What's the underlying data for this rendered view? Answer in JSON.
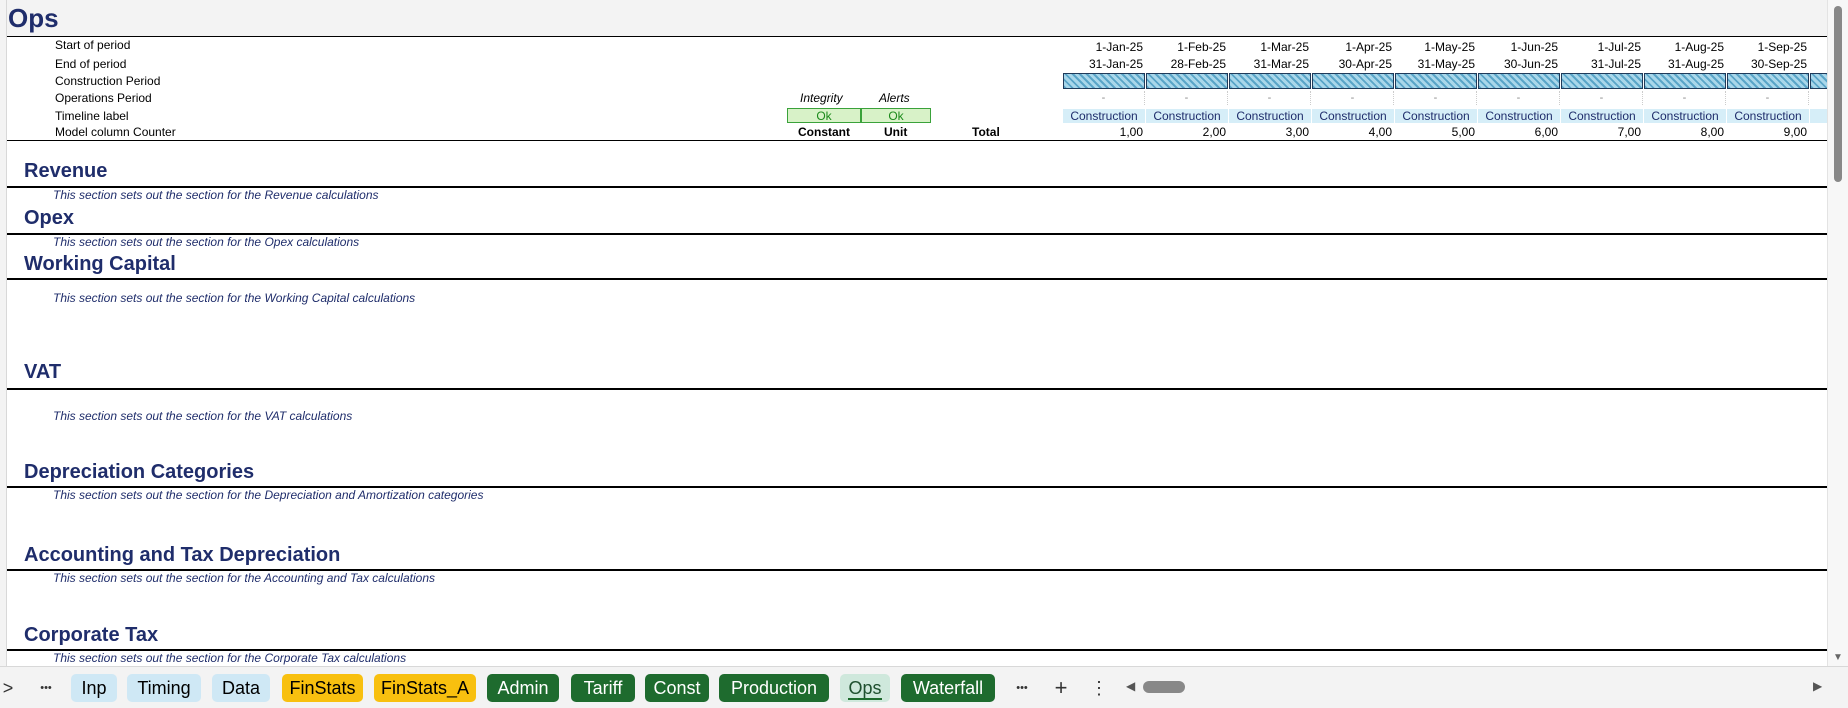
{
  "sheet_title": "Ops",
  "header_labels": [
    "Start of period",
    "End of period",
    "Construction Period",
    "Operations Period",
    "Timeline label",
    "Model column Counter"
  ],
  "checks": {
    "integrity_label": "Integrity",
    "alerts_label": "Alerts",
    "integrity_value": "Ok",
    "alerts_value": "Ok"
  },
  "columns": {
    "constant": "Constant",
    "unit": "Unit",
    "total": "Total"
  },
  "periods": [
    {
      "start": "1-Jan-25",
      "end": "31-Jan-25",
      "ops": "-",
      "label": "Construction",
      "counter": "1,00"
    },
    {
      "start": "1-Feb-25",
      "end": "28-Feb-25",
      "ops": "-",
      "label": "Construction",
      "counter": "2,00"
    },
    {
      "start": "1-Mar-25",
      "end": "31-Mar-25",
      "ops": "-",
      "label": "Construction",
      "counter": "3,00"
    },
    {
      "start": "1-Apr-25",
      "end": "30-Apr-25",
      "ops": "-",
      "label": "Construction",
      "counter": "4,00"
    },
    {
      "start": "1-May-25",
      "end": "31-May-25",
      "ops": "-",
      "label": "Construction",
      "counter": "5,00"
    },
    {
      "start": "1-Jun-25",
      "end": "30-Jun-25",
      "ops": "-",
      "label": "Construction",
      "counter": "6,00"
    },
    {
      "start": "1-Jul-25",
      "end": "31-Jul-25",
      "ops": "-",
      "label": "Construction",
      "counter": "7,00"
    },
    {
      "start": "1-Aug-25",
      "end": "31-Aug-25",
      "ops": "-",
      "label": "Construction",
      "counter": "8,00"
    },
    {
      "start": "1-Sep-25",
      "end": "30-Sep-25",
      "ops": "-",
      "label": "Construction",
      "counter": "9,00"
    },
    {
      "start": "",
      "end": "",
      "ops": "",
      "label": "C",
      "counter": ""
    }
  ],
  "sections": [
    {
      "title": "Revenue",
      "desc": "This section sets out the section for the Revenue calculations"
    },
    {
      "title": "Opex",
      "desc": "This section sets out the section for the Opex calculations"
    },
    {
      "title": "Working Capital",
      "desc": "This section sets out the section for the Working Capital calculations"
    },
    {
      "title": "VAT",
      "desc": "This section sets out the section for the VAT calculations"
    },
    {
      "title": "Depreciation Categories",
      "desc": "This section sets out the section for the Depreciation and Amortization categories"
    },
    {
      "title": "Accounting and Tax Depreciation",
      "desc": "This section sets out the section for the Accounting and Tax calculations"
    },
    {
      "title": "Corporate Tax",
      "desc": "This section sets out the section for the Corporate Tax calculations"
    }
  ],
  "tabs": [
    {
      "label": "Inp",
      "color": "blue"
    },
    {
      "label": "Timing",
      "color": "blue"
    },
    {
      "label": "Data",
      "color": "blue"
    },
    {
      "label": "FinStats",
      "color": "yellow"
    },
    {
      "label": "FinStats_A",
      "color": "yellow"
    },
    {
      "label": "Admin",
      "color": "green"
    },
    {
      "label": "Tariff",
      "color": "green"
    },
    {
      "label": "Const",
      "color": "green"
    },
    {
      "label": "Production",
      "color": "green"
    },
    {
      "label": "Ops",
      "color": "active"
    },
    {
      "label": "Waterfall",
      "color": "green"
    }
  ],
  "tabbar_icons": {
    "prev": ">",
    "more_left": "•••",
    "more_right": "•••",
    "add": "+",
    "options": "⋮",
    "scroll_left": "◀",
    "scroll_right": "▶"
  },
  "scroll_icons": {
    "up": "▲",
    "down": "▼"
  },
  "colors": {
    "title": "#1f2d6b",
    "tab_green": "#1e6b2e",
    "tab_yellow": "#f8c00f",
    "tab_blue": "#cfe8f5"
  }
}
